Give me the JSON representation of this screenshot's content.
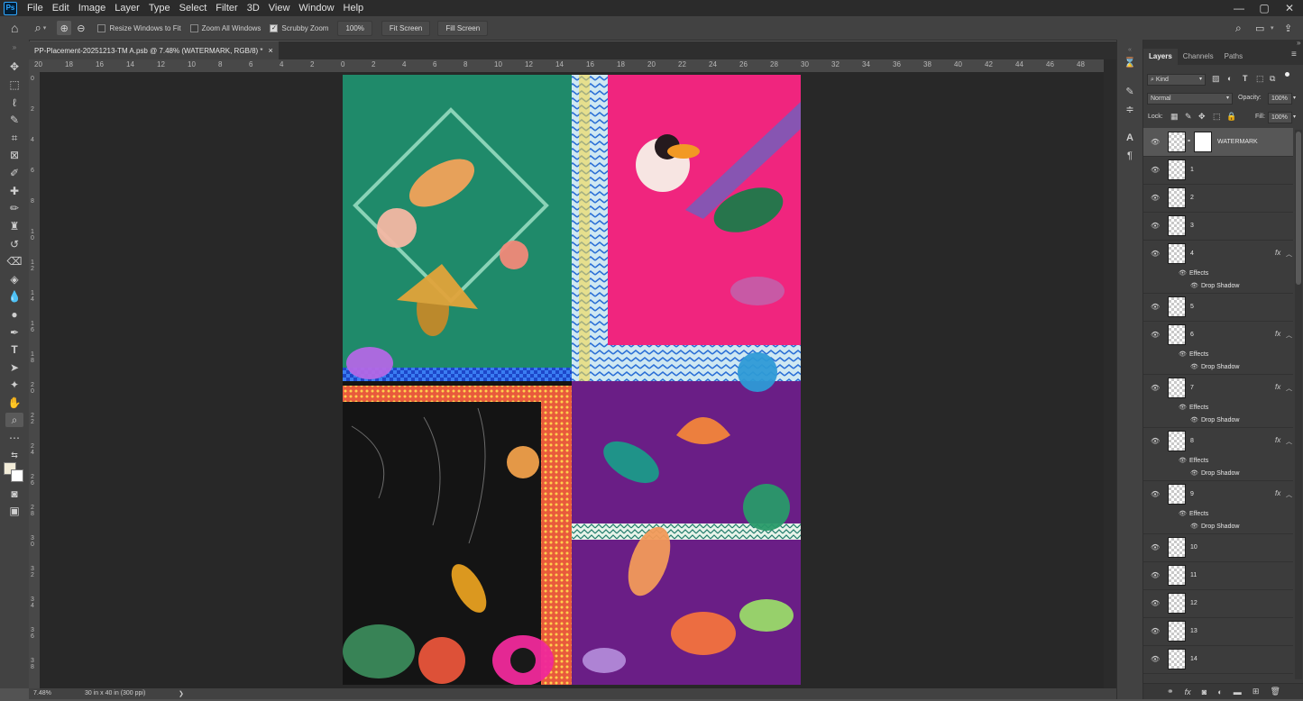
{
  "app": {
    "logo_text": "Ps"
  },
  "menu": [
    "File",
    "Edit",
    "Image",
    "Layer",
    "Type",
    "Select",
    "Filter",
    "3D",
    "View",
    "Window",
    "Help"
  ],
  "window_controls": {
    "minimize": "—",
    "restore": "▢",
    "close": "✕"
  },
  "options_bar": {
    "resize_windows": "Resize Windows to Fit",
    "zoom_all": "Zoom All Windows",
    "scrubby_zoom": "Scrubby Zoom",
    "zoom_value": "100%",
    "fit_screen": "Fit Screen",
    "fill_screen": "Fill Screen",
    "checked": {
      "resize_windows": false,
      "zoom_all": false,
      "scrubby_zoom": true
    }
  },
  "document": {
    "tab_title": "PP-Placement-20251213-TM A.psb @ 7.48% (WATERMARK, RGB/8) *",
    "tab_close": "×"
  },
  "ruler_top": [
    "20",
    "18",
    "16",
    "14",
    "12",
    "10",
    "8",
    "6",
    "4",
    "2",
    "0",
    "2",
    "4",
    "6",
    "8",
    "10",
    "12",
    "14",
    "16",
    "18",
    "20",
    "22",
    "24",
    "26",
    "28",
    "30",
    "32",
    "34",
    "36",
    "38",
    "40",
    "42",
    "44",
    "46",
    "48",
    "50"
  ],
  "ruler_left": [
    "0",
    "2",
    "4",
    "6",
    "8",
    "1 0",
    "1 2",
    "1 4",
    "1 6",
    "1 8",
    "2 0",
    "2 2",
    "2 4",
    "2 6",
    "2 8",
    "3 0",
    "3 2",
    "3 4",
    "3 6",
    "3 8",
    "4 0"
  ],
  "status": {
    "zoom": "7.48%",
    "doc_size": "30 in x 40 in (300 ppi)",
    "arrow": "❯"
  },
  "panel": {
    "tabs": [
      "Layers",
      "Channels",
      "Paths"
    ],
    "active_tab": "Layers",
    "menu_icon": "≡",
    "filter_kind": "Kind",
    "blend_mode": "Normal",
    "opacity_label": "Opacity:",
    "opacity_value": "100%",
    "lock_label": "Lock:",
    "fill_label": "Fill:",
    "fill_value": "100%",
    "effects_label": "Effects",
    "drop_shadow_label": "Drop Shadow",
    "fx_label": "fx",
    "layers": [
      {
        "name": "WATERMARK",
        "has_fx": false,
        "has_mask": true
      },
      {
        "name": "1",
        "has_fx": false
      },
      {
        "name": "2",
        "has_fx": false
      },
      {
        "name": "3",
        "has_fx": false
      },
      {
        "name": "4",
        "has_fx": true
      },
      {
        "name": "5",
        "has_fx": false
      },
      {
        "name": "6",
        "has_fx": true
      },
      {
        "name": "7",
        "has_fx": true
      },
      {
        "name": "8",
        "has_fx": true
      },
      {
        "name": "9",
        "has_fx": true
      },
      {
        "name": "10",
        "has_fx": false
      },
      {
        "name": "11",
        "has_fx": false
      },
      {
        "name": "12",
        "has_fx": false
      },
      {
        "name": "13",
        "has_fx": false
      },
      {
        "name": "14",
        "has_fx": false
      }
    ]
  },
  "colors": {
    "app_bg": "#535353",
    "panel_bg": "#3c3c3c",
    "canvas_bg": "#282828",
    "teal": "#1f8a6a",
    "magenta": "#f0257e",
    "purple": "#6a1e86",
    "black_panel": "#141414"
  }
}
